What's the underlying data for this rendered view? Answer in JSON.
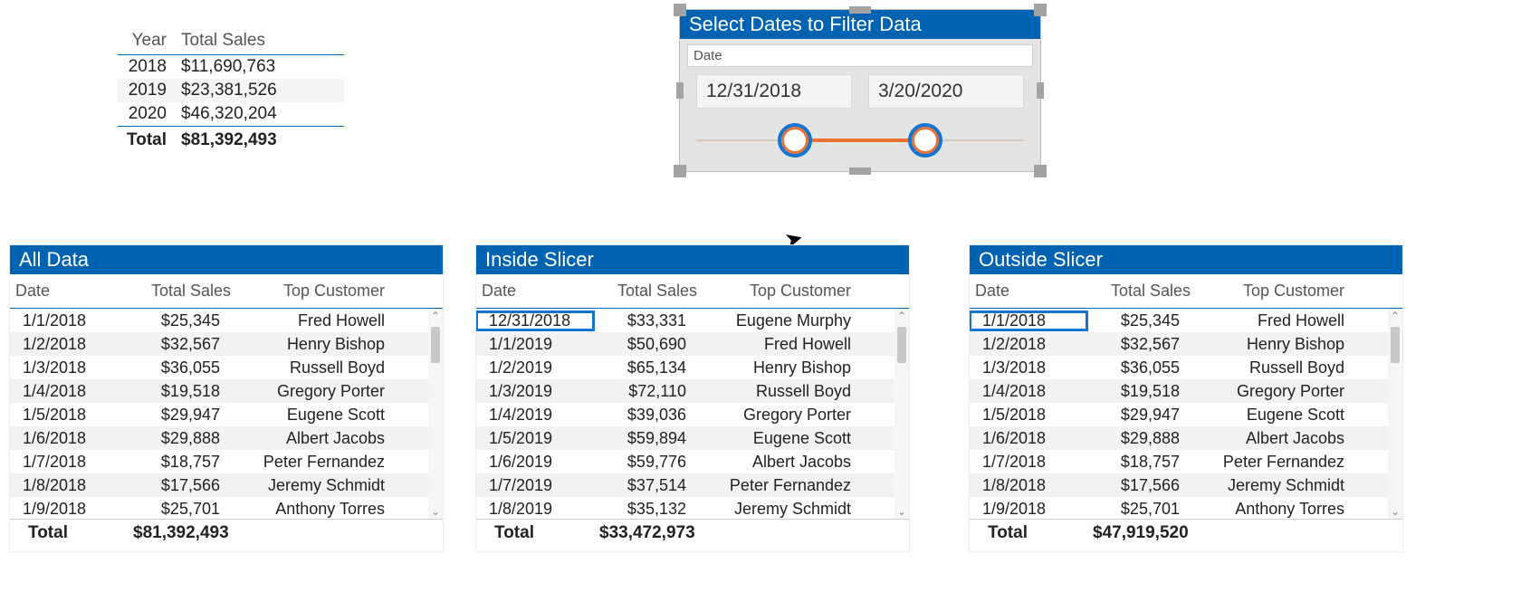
{
  "summary": {
    "headers": [
      "Year",
      "Total Sales"
    ],
    "rows": [
      {
        "year": "2018",
        "total": "$11,690,763"
      },
      {
        "year": "2019",
        "total": "$23,381,526"
      },
      {
        "year": "2020",
        "total": "$46,320,204"
      }
    ],
    "total_label": "Total",
    "total_value": "$81,392,493"
  },
  "slicer": {
    "title": "Select Dates to Filter Data",
    "field_label": "Date",
    "start": "12/31/2018",
    "end": "3/20/2020"
  },
  "panels": {
    "all": {
      "title": "All Data",
      "headers": [
        "Date",
        "Total Sales",
        "Top Customer"
      ],
      "rows": [
        {
          "date": "1/1/2018",
          "sales": "$25,345",
          "cust": "Fred Howell"
        },
        {
          "date": "1/2/2018",
          "sales": "$32,567",
          "cust": "Henry Bishop"
        },
        {
          "date": "1/3/2018",
          "sales": "$36,055",
          "cust": "Russell Boyd"
        },
        {
          "date": "1/4/2018",
          "sales": "$19,518",
          "cust": "Gregory Porter"
        },
        {
          "date": "1/5/2018",
          "sales": "$29,947",
          "cust": "Eugene Scott"
        },
        {
          "date": "1/6/2018",
          "sales": "$29,888",
          "cust": "Albert Jacobs"
        },
        {
          "date": "1/7/2018",
          "sales": "$18,757",
          "cust": "Peter Fernandez"
        },
        {
          "date": "1/8/2018",
          "sales": "$17,566",
          "cust": "Jeremy Schmidt"
        },
        {
          "date": "1/9/2018",
          "sales": "$25,701",
          "cust": "Anthony Torres"
        }
      ],
      "total_label": "Total",
      "total_value": "$81,392,493"
    },
    "inside": {
      "title": "Inside Slicer",
      "headers": [
        "Date",
        "Total Sales",
        "Top Customer"
      ],
      "rows": [
        {
          "date": "12/31/2018",
          "sales": "$33,331",
          "cust": "Eugene Murphy"
        },
        {
          "date": "1/1/2019",
          "sales": "$50,690",
          "cust": "Fred Howell"
        },
        {
          "date": "1/2/2019",
          "sales": "$65,134",
          "cust": "Henry Bishop"
        },
        {
          "date": "1/3/2019",
          "sales": "$72,110",
          "cust": "Russell Boyd"
        },
        {
          "date": "1/4/2019",
          "sales": "$39,036",
          "cust": "Gregory Porter"
        },
        {
          "date": "1/5/2019",
          "sales": "$59,894",
          "cust": "Eugene Scott"
        },
        {
          "date": "1/6/2019",
          "sales": "$59,776",
          "cust": "Albert Jacobs"
        },
        {
          "date": "1/7/2019",
          "sales": "$37,514",
          "cust": "Peter Fernandez"
        },
        {
          "date": "1/8/2019",
          "sales": "$35,132",
          "cust": "Jeremy Schmidt"
        }
      ],
      "total_label": "Total",
      "total_value": "$33,472,973"
    },
    "outside": {
      "title": "Outside Slicer",
      "headers": [
        "Date",
        "Total Sales",
        "Top Customer"
      ],
      "rows": [
        {
          "date": "1/1/2018",
          "sales": "$25,345",
          "cust": "Fred Howell"
        },
        {
          "date": "1/2/2018",
          "sales": "$32,567",
          "cust": "Henry Bishop"
        },
        {
          "date": "1/3/2018",
          "sales": "$36,055",
          "cust": "Russell Boyd"
        },
        {
          "date": "1/4/2018",
          "sales": "$19,518",
          "cust": "Gregory Porter"
        },
        {
          "date": "1/5/2018",
          "sales": "$29,947",
          "cust": "Eugene Scott"
        },
        {
          "date": "1/6/2018",
          "sales": "$29,888",
          "cust": "Albert Jacobs"
        },
        {
          "date": "1/7/2018",
          "sales": "$18,757",
          "cust": "Peter Fernandez"
        },
        {
          "date": "1/8/2018",
          "sales": "$17,566",
          "cust": "Jeremy Schmidt"
        },
        {
          "date": "1/9/2018",
          "sales": "$25,701",
          "cust": "Anthony Torres"
        }
      ],
      "total_label": "Total",
      "total_value": "$47,919,520"
    }
  },
  "chart_data": {
    "type": "table",
    "title": "Total Sales by Year",
    "categories": [
      "2018",
      "2019",
      "2020"
    ],
    "values": [
      11690763,
      23381526,
      46320204
    ],
    "total": 81392493
  }
}
